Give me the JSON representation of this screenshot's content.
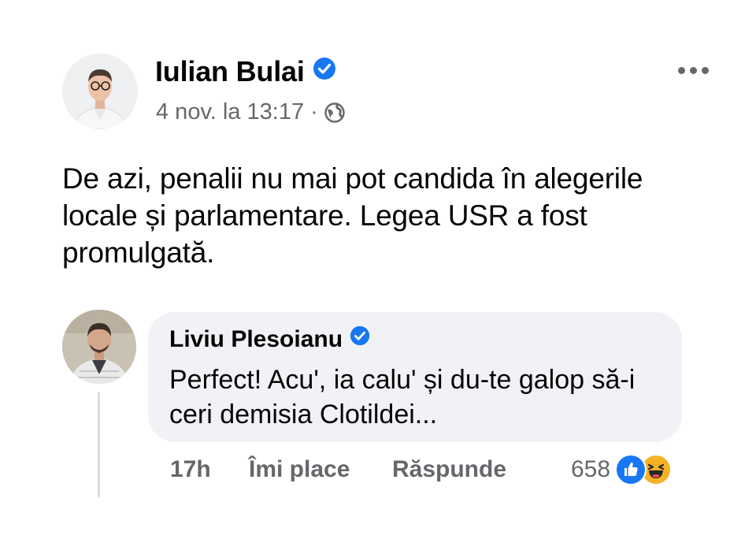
{
  "post": {
    "author": "Iulian Bulai",
    "date": "4 nov. la 13:17",
    "separator": "·",
    "audience_icon": "globe-icon",
    "verified": true,
    "text": "De azi, penalii nu mai pot candida în alegerile locale și parlamentare. Legea USR a fost promulgată.",
    "more_icon": "more-horizontal-icon"
  },
  "comment": {
    "author": "Liviu Plesoianu",
    "verified": true,
    "text": "Perfect! Acu', ia calu' și du-te galop să-i ceri demisia Clotildei...",
    "time": "17h",
    "like_label": "Îmi place",
    "reply_label": "Răspunde",
    "reaction_count": "658",
    "reactions": [
      "like-reaction-icon",
      "haha-reaction-icon"
    ]
  },
  "colors": {
    "text_primary": "#050505",
    "text_secondary": "#65676b",
    "verified_blue": "#1877f2",
    "bubble_bg": "#f0f2f5",
    "haha_yellow": "#f7b125"
  }
}
